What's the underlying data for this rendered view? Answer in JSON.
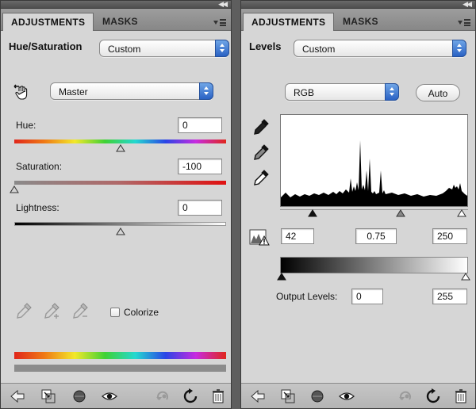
{
  "left_panel": {
    "tabs": [
      {
        "label": "ADJUSTMENTS"
      },
      {
        "label": "MASKS"
      }
    ],
    "title": "Hue/Saturation",
    "preset": "Custom",
    "channel": "Master",
    "hue": {
      "label": "Hue:",
      "value": "0",
      "fraction": 0.5
    },
    "saturation": {
      "label": "Saturation:",
      "value": "-100",
      "fraction": 0.0
    },
    "lightness": {
      "label": "Lightness:",
      "value": "0",
      "fraction": 0.5
    },
    "colorize": {
      "label": "Colorize",
      "checked": false
    },
    "footer_icons": [
      "back-arrow-icon",
      "clip-to-layer-icon",
      "layer-visibility-toggle-icon",
      "eye-icon",
      "previous-state-icon",
      "reset-icon",
      "trash-icon"
    ]
  },
  "right_panel": {
    "tabs": [
      {
        "label": "ADJUSTMENTS"
      },
      {
        "label": "MASKS"
      }
    ],
    "title": "Levels",
    "preset": "Custom",
    "channel": "RGB",
    "auto_label": "Auto",
    "input_levels": {
      "black": "42",
      "gamma": "0.75",
      "white": "250"
    },
    "output_levels": {
      "label": "Output Levels:",
      "black": "0",
      "white": "255"
    },
    "footer_icons": [
      "back-arrow-icon",
      "clip-to-layer-icon",
      "layer-visibility-toggle-icon",
      "eye-icon",
      "previous-state-icon",
      "reset-icon",
      "trash-icon"
    ]
  },
  "colors": {
    "panel_bg": "#d6d6d6",
    "tab_bar": "#8f8f8f",
    "dropdown_accent": "#3a72d2"
  }
}
